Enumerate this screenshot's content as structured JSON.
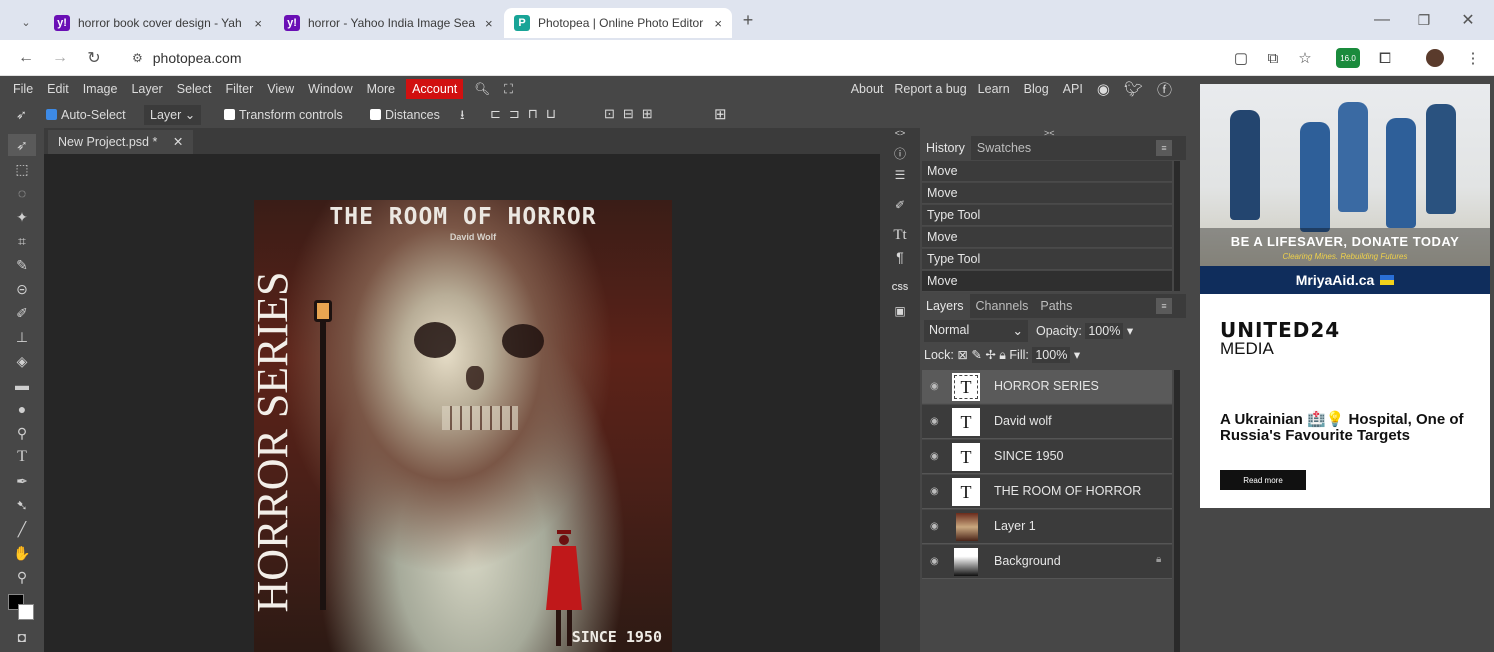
{
  "browser": {
    "tabs": [
      {
        "title": "horror book cover design - Yah",
        "favicon_color": "#6a0fb5",
        "favicon_letter": "y!"
      },
      {
        "title": "horror - Yahoo India Image Sea",
        "favicon_color": "#6a0fb5",
        "favicon_letter": "y!"
      },
      {
        "title": "Photopea | Online Photo Editor",
        "favicon_color": "#18a497",
        "favicon_letter": "P"
      }
    ],
    "tab_close": "×",
    "new_tab": "+",
    "url": "photopea.com",
    "extension_badge": "16.0"
  },
  "app": {
    "menu": [
      "File",
      "Edit",
      "Image",
      "Layer",
      "Select",
      "Filter",
      "View",
      "Window",
      "More"
    ],
    "account_label": "Account",
    "right_menu": [
      "About",
      "Report a bug",
      "Learn",
      "Blog",
      "API"
    ],
    "options": {
      "auto_select_label": "Auto-Select",
      "auto_select_mode": "Layer",
      "transform_controls_label": "Transform controls",
      "distances_label": "Distances"
    },
    "document_tab": "New Project.psd *",
    "history_panel": {
      "tabs": [
        "History",
        "Swatches"
      ],
      "items": [
        "Move",
        "Move",
        "Type Tool",
        "Move",
        "Type Tool",
        "Move"
      ]
    },
    "layers_panel": {
      "tabs": [
        "Layers",
        "Channels",
        "Paths"
      ],
      "blend_mode": "Normal",
      "opacity_label": "Opacity:",
      "opacity_value": "100%",
      "lock_label": "Lock:",
      "fill_label": "Fill:",
      "fill_value": "100%",
      "layers": [
        {
          "name": "HORROR SERIES",
          "type": "text",
          "thumb_letter": "T"
        },
        {
          "name": "David wolf",
          "type": "text",
          "thumb_letter": "T"
        },
        {
          "name": "SINCE 1950",
          "type": "text",
          "thumb_letter": "T"
        },
        {
          "name": "THE ROOM OF HORROR",
          "type": "text",
          "thumb_letter": "T"
        },
        {
          "name": "Layer 1",
          "type": "image",
          "thumb_letter": ""
        },
        {
          "name": "Background",
          "type": "image",
          "thumb_letter": ""
        }
      ]
    }
  },
  "cover": {
    "title": "THE ROOM OF HORROR",
    "author": "David Wolf",
    "series": "HORROR SERIES",
    "since": "SINCE 1950"
  },
  "ad": {
    "banner_line1": "BE A LIFESAVER, DONATE TODAY",
    "banner_line2": "Clearing Mines. Rebuilding Futures",
    "site": "MriyaAid.ca",
    "logo_line1": "UNITED24",
    "logo_line2": "MEDIA",
    "headline": "A Ukrainian 🏥💡 Hospital, One of Russia's Favourite Targets",
    "cta": "Read more"
  },
  "colors": {
    "account_red": "#d11010",
    "panel_dark": "#3b3b3b",
    "panel_mid": "#474747",
    "canvas_bg": "#262626",
    "ad_navy": "#0f2d5c"
  }
}
